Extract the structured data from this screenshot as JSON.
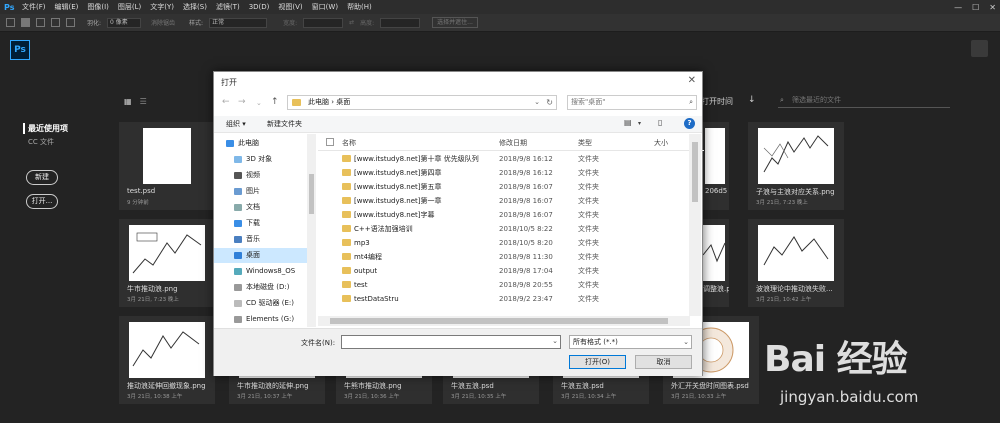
{
  "menubar": {
    "logo": "Ps",
    "items": [
      "文件(F)",
      "编辑(E)",
      "图像(I)",
      "图层(L)",
      "文字(Y)",
      "选择(S)",
      "滤镜(T)",
      "3D(D)",
      "视图(V)",
      "窗口(W)",
      "帮助(H)"
    ],
    "min_glyph": "—",
    "max_glyph": "☐",
    "close_glyph": "✕"
  },
  "optbar": {
    "feather_label": "羽化:",
    "feather_value": "0 像素",
    "antialias_label": "消除锯齿",
    "style_label": "样式:",
    "style_value": "正常",
    "width_label": "宽度:",
    "height_label": "高度:",
    "select_mask": "选择并遮住..."
  },
  "workspace": {
    "logo": "Ps",
    "recent": "最近使用项",
    "cc_files": "CC 文件",
    "new_btn": "新建",
    "open_btn": "打开...",
    "sort_label": "打开时间",
    "search_placeholder": "筛选最近的文件",
    "cards": [
      {
        "name": "test.psd",
        "date": "9 分钟前"
      },
      {
        "name": "",
        "date": ""
      },
      {
        "name": "",
        "date": ""
      },
      {
        "name": "",
        "date": ""
      },
      {
        "name": "",
        "date": ""
      },
      {
        "name": "",
        "date": ""
      },
      {
        "name": "206d56b07ec5",
        "date": ""
      },
      {
        "name": "子浪与主浪对应关系.png",
        "date": "3月 21日, 7:23 晚上"
      },
      {
        "name": "牛市推动浪.png",
        "date": "3月 21日, 7:23 晚上"
      },
      {
        "name": "",
        "date": ""
      },
      {
        "name": "",
        "date": ""
      },
      {
        "name": "",
        "date": ""
      },
      {
        "name": "",
        "date": ""
      },
      {
        "name": "",
        "date": ""
      },
      {
        "name": "调整浪.png",
        "date": ""
      },
      {
        "name": "波浪理论中推动浪失败...",
        "date": "3月 21日, 10:42 上午"
      },
      {
        "name": "推动浪延伸回撤现象.png",
        "date": "3月 21日, 10:38 上午"
      },
      {
        "name": "牛市推动浪的延伸.png",
        "date": "3月 21日, 10:37 上午"
      },
      {
        "name": "牛熊市推动浪.png",
        "date": "3月 21日, 10:36 上午"
      },
      {
        "name": "牛浪五浪.psd",
        "date": "3月 21日, 10:35 上午"
      },
      {
        "name": "牛浪五浪.psd",
        "date": "3月 21日, 10:34 上午"
      },
      {
        "name": "外汇开关盘时间图表.psd",
        "date": "3月 21日, 10:33 上午"
      }
    ]
  },
  "dialog": {
    "title": "打开",
    "close_glyph": "✕",
    "back": "←",
    "forward": "→",
    "recent": "⌄",
    "up": "↑",
    "address": "此电脑 › 桌面",
    "search_placeholder": "搜索\"桌面\"",
    "organize": "组织 ▾",
    "new_folder": "新建文件夹",
    "help": "?",
    "sidebar": [
      {
        "label": "此电脑",
        "indent": 0
      },
      {
        "label": "3D 对象",
        "indent": 1
      },
      {
        "label": "视频",
        "indent": 1
      },
      {
        "label": "图片",
        "indent": 1
      },
      {
        "label": "文档",
        "indent": 1
      },
      {
        "label": "下载",
        "indent": 1
      },
      {
        "label": "音乐",
        "indent": 1
      },
      {
        "label": "桌面",
        "indent": 1,
        "selected": true
      },
      {
        "label": "Windows8_OS",
        "indent": 1
      },
      {
        "label": "本地磁盘 (D:)",
        "indent": 1
      },
      {
        "label": "CD 驱动器 (E:)",
        "indent": 1
      },
      {
        "label": "Elements (G:)",
        "indent": 1
      }
    ],
    "columns": {
      "name": "名称",
      "date": "修改日期",
      "type": "类型",
      "size": "大小"
    },
    "files": [
      {
        "name": "[www.itstudy8.net]第十章 优先级队列",
        "date": "2018/9/8 16:12",
        "type": "文件夹"
      },
      {
        "name": "[www.itstudy8.net]第四章",
        "date": "2018/9/8 16:12",
        "type": "文件夹"
      },
      {
        "name": "[www.itstudy8.net]第五章",
        "date": "2018/9/8 16:07",
        "type": "文件夹"
      },
      {
        "name": "[www.itstudy8.net]第一章",
        "date": "2018/9/8 16:07",
        "type": "文件夹"
      },
      {
        "name": "[www.itstudy8.net]字幕",
        "date": "2018/9/8 16:07",
        "type": "文件夹"
      },
      {
        "name": "C++语法加强培训",
        "date": "2018/10/5 8:22",
        "type": "文件夹"
      },
      {
        "name": "mp3",
        "date": "2018/10/5 8:20",
        "type": "文件夹"
      },
      {
        "name": "mt4编程",
        "date": "2018/9/8 11:30",
        "type": "文件夹"
      },
      {
        "name": "output",
        "date": "2018/9/8 17:04",
        "type": "文件夹"
      },
      {
        "name": "test",
        "date": "2018/9/8 20:55",
        "type": "文件夹"
      },
      {
        "name": "testDataStru",
        "date": "2018/9/2 23:47",
        "type": "文件夹"
      }
    ],
    "filename_label": "文件名(N):",
    "filename_value": "",
    "filter": "所有格式 (*.*)",
    "open_btn": "打开(O)",
    "cancel_btn": "取消"
  },
  "watermark": {
    "logo": "Bai 经验",
    "url": "jingyan.baidu.com"
  }
}
